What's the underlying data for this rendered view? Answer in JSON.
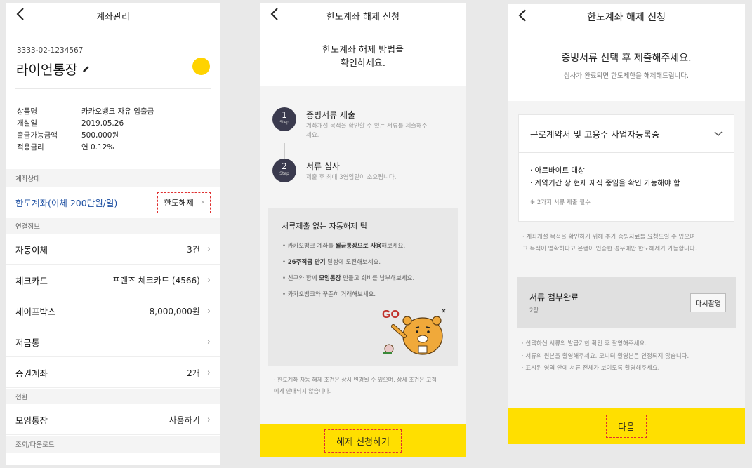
{
  "screen1": {
    "title": "계좌관리",
    "account_number": "3333-02-1234567",
    "account_name": "라이언통장",
    "info": [
      {
        "label": "상품명",
        "value": "카카오뱅크 자유 입출금"
      },
      {
        "label": "개설일",
        "value": "2019.05.26"
      },
      {
        "label": "출금가능금액",
        "value": "500,000원"
      },
      {
        "label": "적용금리",
        "value": "연 0.12%"
      }
    ],
    "section_status": "계좌상태",
    "limit_label": "한도계좌(이체 200만원/일)",
    "limit_action": "한도해제",
    "section_linked": "연결정보",
    "linked": [
      {
        "label": "자동이체",
        "value": "3건"
      },
      {
        "label": "체크카드",
        "value": "프렌즈 체크카드 (4566)"
      },
      {
        "label": "세이프박스",
        "value": "8,000,000원"
      },
      {
        "label": "저금통",
        "value": ""
      },
      {
        "label": "증권계좌",
        "value": "2개"
      }
    ],
    "section_convert": "전환",
    "group_label": "모임통장",
    "group_action": "사용하기",
    "section_download": "조회/다운로드"
  },
  "screen2": {
    "title": "한도계좌 해제 신청",
    "heading_line1": "한도계좌 해제 방법을",
    "heading_line2": "확인하세요.",
    "steps": [
      {
        "num": "1",
        "step": "Step",
        "title": "증빙서류 제출",
        "desc1": "계좌개설 목적을 확인할 수 있는 서류를 제출해주",
        "desc2": "세요."
      },
      {
        "num": "2",
        "step": "Step",
        "title": "서류 심사",
        "desc1": "제출 후 최대 3영업일이 소요됩니다.",
        "desc2": ""
      }
    ],
    "tip_title": "서류제출 없는 자동해제 팁",
    "tips": [
      {
        "pre": "카카오뱅크 계좌를 ",
        "bold": "월급통장으로 사용",
        "post": "해보세요."
      },
      {
        "pre": "",
        "bold": "26주적금 만기",
        "post": " 달성에 도전해보세요."
      },
      {
        "pre": "친구와 함께 ",
        "bold": "모임통장",
        "post": " 만들고 회비를 납부해보세요."
      },
      {
        "pre": "카카오뱅크와 꾸준히 거래해보세요.",
        "bold": "",
        "post": ""
      }
    ],
    "sticker_text": "GO",
    "note_line1": "· 한도계좌 자동 해제 조건은 상시 변경될 수 있으며, 상세 조건은 고객",
    "note_line2": "에게 안내되지 않습니다.",
    "cta": "해제 신청하기"
  },
  "screen3": {
    "title": "한도계좌 해제 신청",
    "heading": "증빙서류 선택 후 제출해주세요.",
    "subheading": "심사가 완료되면 한도제한을 해제해드립니다.",
    "doc_select": "근로계약서 및 고용주 사업자등록증",
    "doc_items": [
      "· 아르바이트 대상",
      "· 계약기간 상 현재 재직 중임을 확인 가능해야 함"
    ],
    "doc_note": "※ 2가지 서류 제출 필수",
    "note_a1": "· 계좌개설 목적을 확인하기 위해 추가 증빙자료를 요청드릴 수 있으며",
    "note_a2": "그 목적이 명확하다고 은행이 인증한 경우에만 한도해제가 가능합니다.",
    "attach_title": "서류 첨부완료",
    "attach_count": "2장",
    "retake": "다시촬영",
    "notes_b": [
      "· 선택하신 서류의 발급기한 확인 후 촬영해주세요.",
      "· 서류의 원본을 촬영해주세요. 모니터 촬영본은 인정되지 않습니다.",
      "· 표시된 영역 안에 서류 전체가 보이도록 촬영해주세요."
    ],
    "cta": "다음"
  },
  "colors": {
    "accent_yellow": "#ffdf00",
    "coin": "#ffd300",
    "limit_blue": "#1e50a2",
    "highlight_red": "#e03030"
  }
}
